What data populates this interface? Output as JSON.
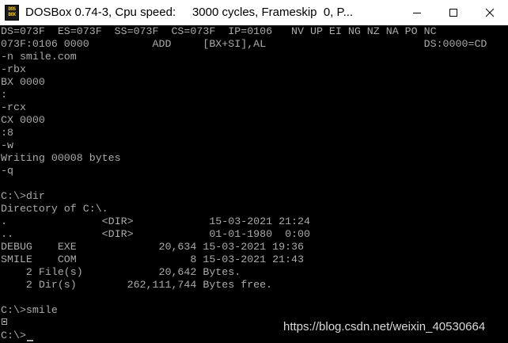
{
  "window": {
    "icon_text_top": "DOS",
    "icon_text_bottom": "BOX",
    "title": "DOSBox 0.74-3, Cpu speed:     3000 cycles, Frameskip  0, P...",
    "minimize_icon": "minimize-icon",
    "maximize_icon": "maximize-icon",
    "close_icon": "close-icon"
  },
  "terminal": {
    "lines": [
      "DS=073F  ES=073F  SS=073F  CS=073F  IP=0106   NV UP EI NG NZ NA PO NC",
      "073F:0106 0000          ADD     [BX+SI],AL                         DS:0000=CD",
      "-n smile.com",
      "-rbx",
      "BX 0000",
      ":",
      "-rcx",
      "CX 0000",
      ":8",
      "-w",
      "Writing 00008 bytes",
      "-q",
      "",
      "C:\\>dir",
      "Directory of C:\\.",
      ".               <DIR>            15-03-2021 21:24",
      "..              <DIR>            01-01-1980  0:00",
      "DEBUG    EXE             20,634 15-03-2021 19:36",
      "SMILE    COM                  8 15-03-2021 21:43",
      "    2 File(s)            20,642 Bytes.",
      "    2 Dir(s)        262,111,744 Bytes free.",
      "",
      "C:\\>smile",
      "",
      "C:\\>"
    ],
    "smile_output_glyph": "smiley-glyph-icon",
    "text_color": "#aaaaaa",
    "background_color": "#000000"
  },
  "watermark": "https://blog.csdn.net/weixin_40530664"
}
